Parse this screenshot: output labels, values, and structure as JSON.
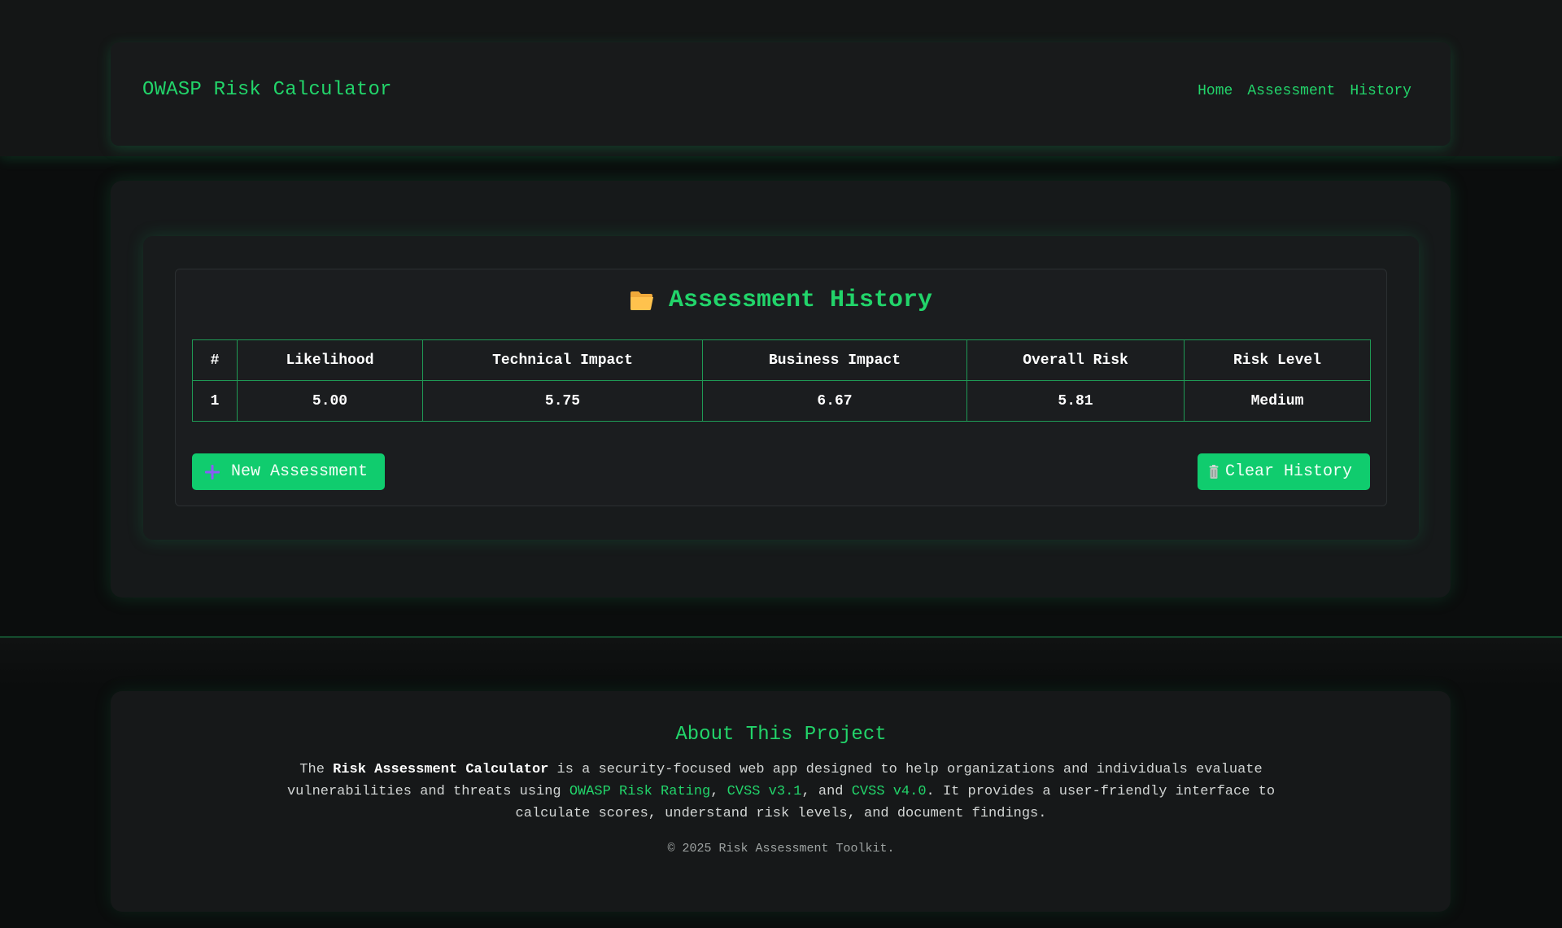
{
  "header": {
    "brand": "OWASP Risk Calculator",
    "nav": [
      "Home",
      "Assessment",
      "History"
    ]
  },
  "history": {
    "title": "Assessment History",
    "title_icon": "folder-icon",
    "columns": [
      "#",
      "Likelihood",
      "Technical Impact",
      "Business Impact",
      "Overall Risk",
      "Risk Level"
    ],
    "rows": [
      [
        "1",
        "5.00",
        "5.75",
        "6.67",
        "5.81",
        "Medium"
      ]
    ],
    "new_button": "New Assessment",
    "new_button_icon": "plus-icon",
    "clear_button": "Clear History",
    "clear_button_icon": "trash-icon"
  },
  "about": {
    "title": "About This Project",
    "p1": "The ",
    "p_bold": "Risk Assessment Calculator",
    "p2": " is a security-focused web app designed to help organizations and individuals evaluate vulnerabilities and threats using ",
    "link1": "OWASP Risk Rating",
    "sep1": ", ",
    "link2": "CVSS v3.1",
    "sep2": ", and ",
    "link3": "CVSS v4.0",
    "p3": ". It provides a user-friendly interface to calculate scores, understand risk levels, and document findings.",
    "copyright": "© 2025 Risk Assessment Toolkit."
  },
  "colors": {
    "accent": "#22d46a",
    "button": "#10cc6e",
    "background": "#0b0d0d",
    "table_border": "#1f9a55"
  }
}
